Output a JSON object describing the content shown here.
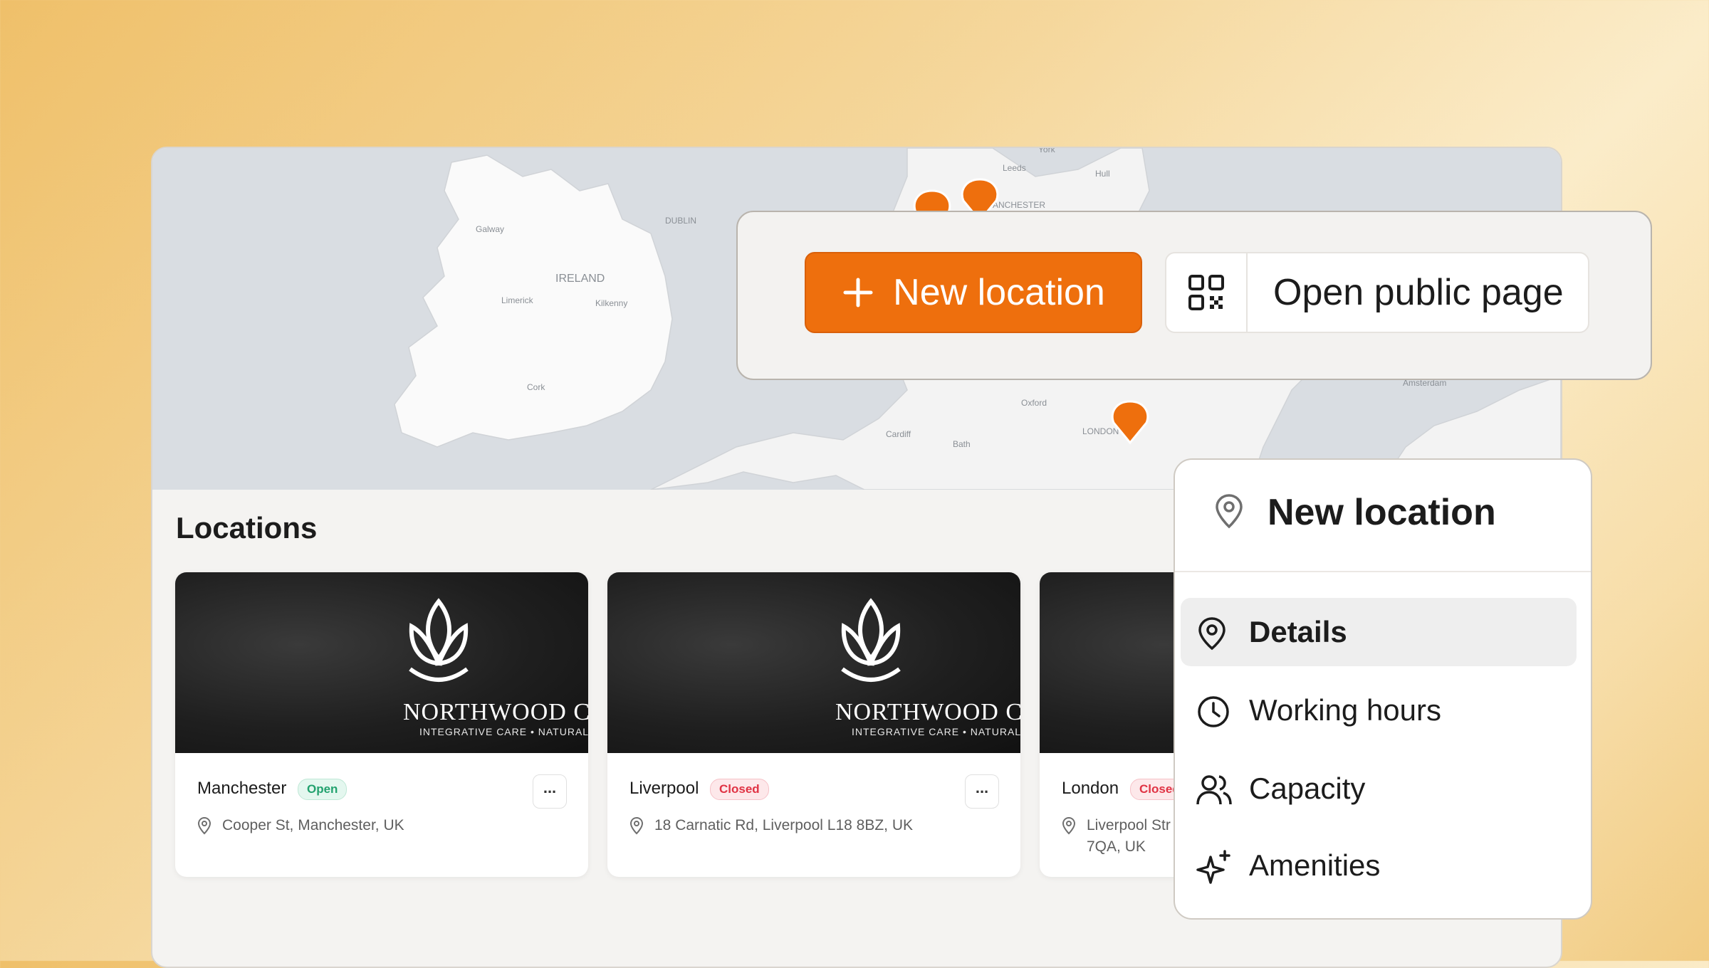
{
  "map": {
    "labels": [
      "IRELAND",
      "DUBLIN",
      "Galway",
      "Limerick",
      "Kilkenny",
      "Cork",
      "Leeds",
      "York",
      "Hull",
      "MANCHESTER",
      "Oxford",
      "Cardiff",
      "Bath",
      "LONDON",
      "Amsterdam"
    ],
    "pin_color": "#ee6f0d"
  },
  "locations": {
    "title": "Locations",
    "cards": [
      {
        "name": "Manchester",
        "status": "Open",
        "address_line1": "Cooper St, Manchester, UK",
        "address_line2": "",
        "brand_name": "NORTHWOOD CL",
        "brand_tagline": "INTEGRATIVE CARE • NATURAL WEL",
        "more": "..."
      },
      {
        "name": "Liverpool",
        "status": "Closed",
        "address_line1": "18 Carnatic Rd, Liverpool L18 8BZ, UK",
        "address_line2": "",
        "brand_name": "NORTHWOOD CL",
        "brand_tagline": "INTEGRATIVE CARE • NATURAL WEL",
        "more": "..."
      },
      {
        "name": "London",
        "status": "Closed",
        "address_line1": "Liverpool Str",
        "address_line2": "7QA, UK",
        "more": "..."
      }
    ]
  },
  "actions": {
    "new_location_label": "New location",
    "new_location_icon": "plus-icon",
    "open_public_label": "Open public page",
    "open_public_icon": "qr-code-icon"
  },
  "menu": {
    "title": "New location",
    "title_icon": "location-pin-icon",
    "items": [
      {
        "label": "Details",
        "icon": "location-pin-icon",
        "active": true
      },
      {
        "label": "Working hours",
        "icon": "clock-icon",
        "active": false
      },
      {
        "label": "Capacity",
        "icon": "users-icon",
        "active": false
      },
      {
        "label": "Amenities",
        "icon": "sparkles-icon",
        "active": false
      }
    ]
  },
  "colors": {
    "accent": "#ee6f0d",
    "open_status": "#23a26f",
    "closed_status": "#e03344"
  }
}
